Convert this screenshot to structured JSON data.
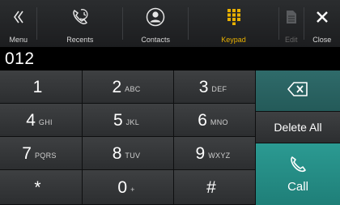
{
  "nav": {
    "menu": {
      "label": "Menu",
      "icon": "double-chevron-left-icon"
    },
    "recents": {
      "label": "Recents",
      "icon": "phone-history-icon"
    },
    "contacts": {
      "label": "Contacts",
      "icon": "person-icon"
    },
    "keypad": {
      "label": "Keypad",
      "icon": "keypad-grid-icon"
    },
    "edit": {
      "label": "Edit",
      "icon": "document-icon"
    },
    "close": {
      "label": "Close",
      "icon": "close-x-icon"
    }
  },
  "display": {
    "number": "012"
  },
  "keys": [
    {
      "digit": "1",
      "letters": ""
    },
    {
      "digit": "2",
      "letters": "ABC"
    },
    {
      "digit": "3",
      "letters": "DEF"
    },
    {
      "digit": "4",
      "letters": "GHI"
    },
    {
      "digit": "5",
      "letters": "JKL"
    },
    {
      "digit": "6",
      "letters": "MNO"
    },
    {
      "digit": "7",
      "letters": "PQRS"
    },
    {
      "digit": "8",
      "letters": "TUV"
    },
    {
      "digit": "9",
      "letters": "WXYZ"
    },
    {
      "digit": "*",
      "letters": ""
    },
    {
      "digit": "0",
      "letters": "+"
    },
    {
      "digit": "#",
      "letters": ""
    }
  ],
  "actions": {
    "backspace_icon": "backspace-icon",
    "delete_all": "Delete All",
    "call": "Call",
    "call_icon": "phone-handset-icon"
  },
  "colors": {
    "active_tab": "#e8b000",
    "backspace_bg": "#2f6b6a",
    "call_bg": "#2b9a92"
  }
}
